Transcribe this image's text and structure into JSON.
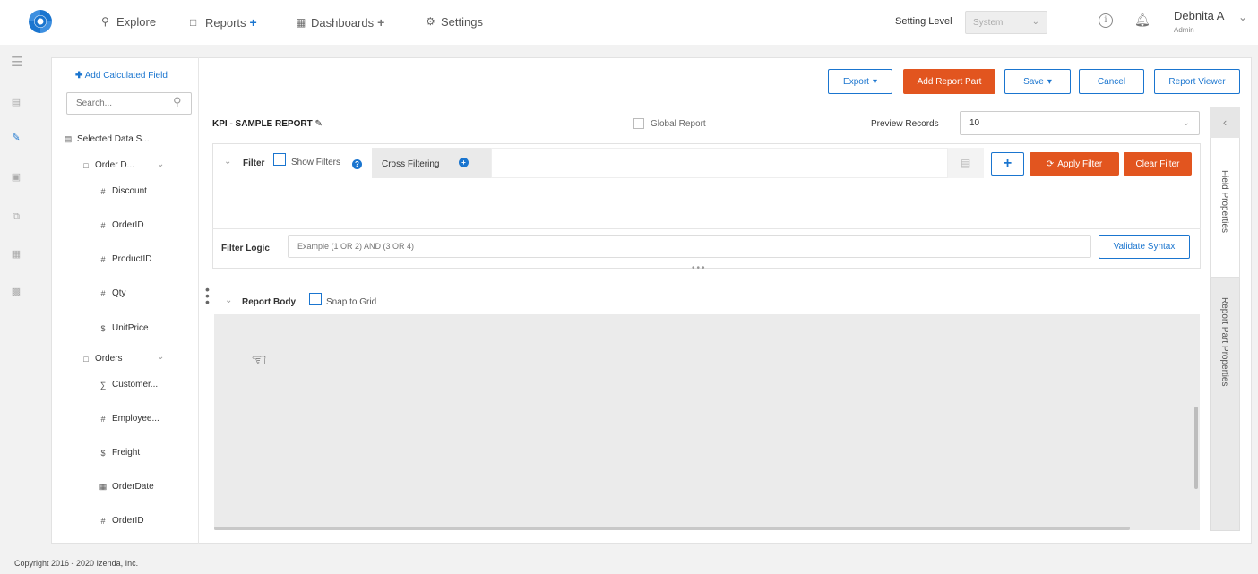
{
  "nav": {
    "explore": "Explore",
    "reports": "Reports",
    "dashboards": "Dashboards",
    "settings": "Settings",
    "setting_level_label": "Setting Level",
    "setting_level_value": "System",
    "user_name": "Debnita A",
    "user_role": "Admin",
    "accent_color": "#1a75cf"
  },
  "fields": {
    "add_calculated_field": "Add Calculated Field",
    "search_placeholder": "Search...",
    "selected_data_source": "Selected Data S...",
    "order_details": "Order D...",
    "discount": "Discount",
    "orderid": "OrderID",
    "productid": "ProductID",
    "qty": "Qty",
    "unitprice": "UnitPrice",
    "orders": "Orders",
    "customer": "Customer...",
    "employee": "Employee...",
    "freight": "Freight",
    "orderdate": "OrderDate",
    "orderid2": "OrderID"
  },
  "toolbar": {
    "export": "Export",
    "add_report_part": "Add Report Part",
    "save": "Save",
    "cancel": "Cancel",
    "report_viewer": "Report Viewer",
    "orange_color": "#e2551f"
  },
  "report": {
    "title": "KPI - SAMPLE REPORT",
    "global_report": "Global Report",
    "preview_records_label": "Preview Records",
    "preview_records_value": "10"
  },
  "filter": {
    "label": "Filter",
    "show_filters": "Show Filters",
    "cross_filtering": "Cross Filtering",
    "apply_filter": "Apply Filter",
    "clear_filter": "Clear Filter",
    "filter_logic_label": "Filter Logic",
    "filter_logic_placeholder": "Example (1 OR 2) AND (3 OR 4)",
    "validate_syntax": "Validate Syntax"
  },
  "body": {
    "label": "Report Body",
    "snap_to_grid": "Snap to Grid"
  },
  "side": {
    "field_properties": "Field Properties",
    "report_part_properties": "Report Part Properties"
  },
  "footer": {
    "copyright": "Copyright 2016 - 2020 Izenda, Inc."
  }
}
